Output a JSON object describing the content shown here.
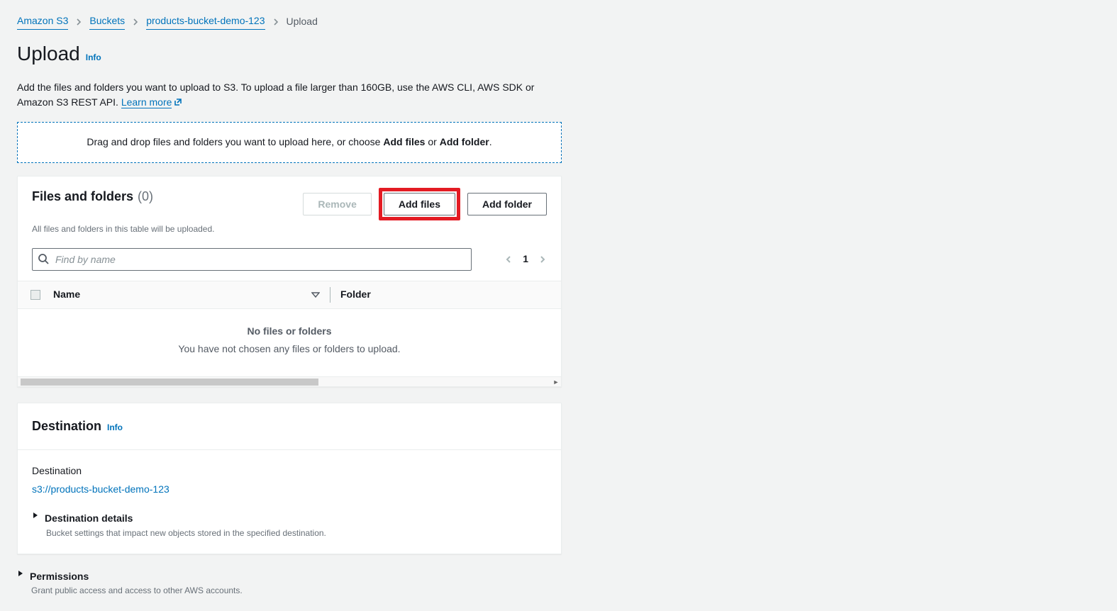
{
  "breadcrumb": {
    "s3": "Amazon S3",
    "buckets": "Buckets",
    "bucket_name": "products-bucket-demo-123",
    "current": "Upload"
  },
  "title": "Upload",
  "info_label": "Info",
  "intro_text": "Add the files and folders you want to upload to S3. To upload a file larger than 160GB, use the AWS CLI, AWS SDK or Amazon S3 REST API. ",
  "learn_more": "Learn more",
  "dropzone": {
    "prefix": "Drag and drop files and folders you want to upload here, or choose ",
    "add_files": "Add files",
    "or": " or ",
    "add_folder": "Add folder",
    "suffix": "."
  },
  "files_panel": {
    "title": "Files and folders",
    "count": "(0)",
    "subtitle": "All files and folders in this table will be uploaded.",
    "remove_btn": "Remove",
    "add_files_btn": "Add files",
    "add_folder_btn": "Add folder",
    "search_placeholder": "Find by name",
    "page_num": "1",
    "col_name": "Name",
    "col_folder": "Folder",
    "empty_title": "No files or folders",
    "empty_sub": "You have not chosen any files or folders to upload."
  },
  "destination": {
    "title": "Destination",
    "label": "Destination",
    "link": "s3://products-bucket-demo-123",
    "details_title": "Destination details",
    "details_desc": "Bucket settings that impact new objects stored in the specified destination."
  },
  "permissions": {
    "title": "Permissions",
    "desc": "Grant public access and access to other AWS accounts."
  }
}
